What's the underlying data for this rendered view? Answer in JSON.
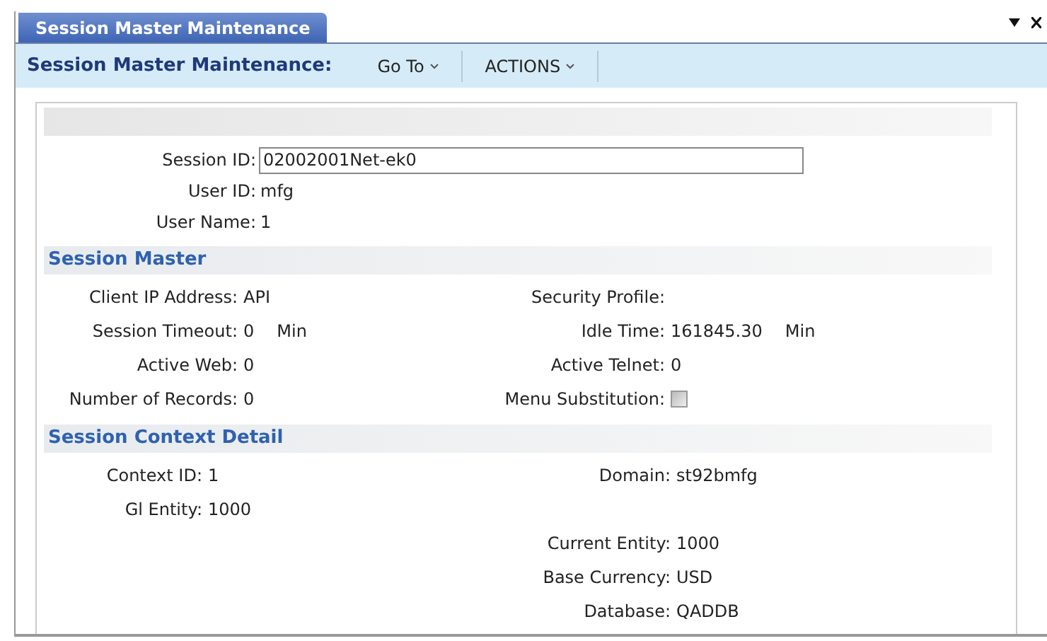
{
  "tab": {
    "label": "Session Master Maintenance",
    "selected": true
  },
  "toolbar": {
    "title": "Session Master Maintenance:",
    "menus": [
      "Go To",
      "ACTIONS"
    ]
  },
  "header_fields": [
    {
      "label": "Session ID:",
      "value": "02002001Net-ek0",
      "kind": "input"
    },
    {
      "label": "User ID:",
      "value": "mfg",
      "kind": "text"
    },
    {
      "label": "User Name:",
      "value": "1",
      "kind": "text"
    }
  ],
  "sections": [
    {
      "title": "Session Master",
      "rows": [
        {
          "left": {
            "label": "Client IP Address:",
            "value": "API"
          },
          "right": {
            "label": "Security Profile:"
          }
        },
        {
          "left": {
            "label": "Session Timeout:",
            "value": "0",
            "unit": "Min"
          },
          "right": {
            "label": "Idle Time:",
            "value": "161845.30",
            "unit": "Min"
          }
        },
        {
          "left": {
            "label": "Active Web:",
            "value": "0"
          },
          "right": {
            "label": "Active Telnet:",
            "value": "0"
          }
        },
        {
          "left": {
            "label": "Number of Records:",
            "value": "0"
          },
          "right": {
            "label": "Menu Substitution:",
            "kind": "checkbox",
            "checked": false
          }
        }
      ]
    },
    {
      "title": "Session Context Detail",
      "rows": [
        {
          "left": {
            "label": "Context ID:",
            "value": "1"
          },
          "right": {
            "label": "Domain:",
            "value": "st92bmfg"
          }
        },
        {
          "left": {
            "label": "Gl Entity:",
            "value": "1000"
          }
        },
        {
          "right": {
            "label": "Current Entity:",
            "value": "1000"
          }
        },
        {
          "right": {
            "label": "Base Currency:",
            "value": "USD"
          }
        },
        {
          "right": {
            "label": "Database:",
            "value": "QADDB"
          }
        }
      ]
    }
  ]
}
